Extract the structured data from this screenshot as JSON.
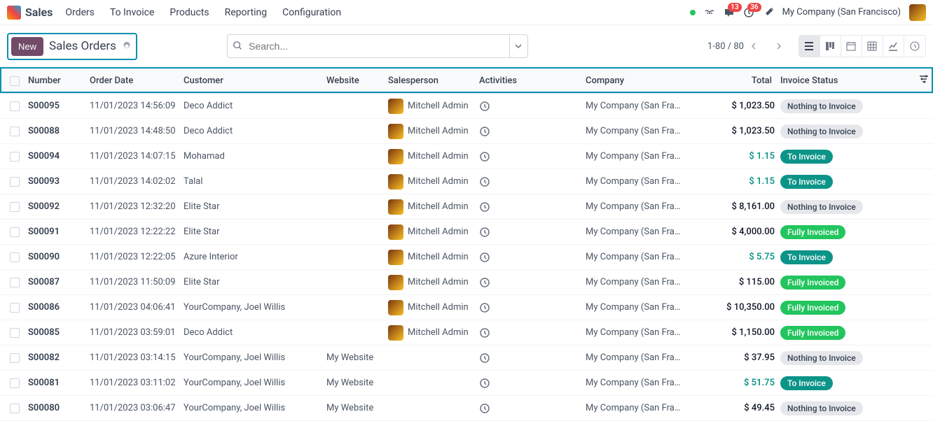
{
  "app": {
    "name": "Sales"
  },
  "nav": {
    "links": [
      "Orders",
      "To Invoice",
      "Products",
      "Reporting",
      "Configuration"
    ]
  },
  "top_right": {
    "msg_count": "13",
    "activity_count": "36",
    "company": "My Company (San Francisco)"
  },
  "breadcrumb": {
    "new_label": "New",
    "title": "Sales Orders"
  },
  "search": {
    "placeholder": "Search..."
  },
  "pager": {
    "text": "1-80 / 80"
  },
  "headers": {
    "number": "Number",
    "order_date": "Order Date",
    "customer": "Customer",
    "website": "Website",
    "salesperson": "Salesperson",
    "activities": "Activities",
    "company": "Company",
    "total": "Total",
    "invoice_status": "Invoice Status"
  },
  "statuses": {
    "nothing": "Nothing to Invoice",
    "to_invoice": "To Invoice",
    "fully": "Fully Invoiced"
  },
  "rows": [
    {
      "number": "S00095",
      "date": "11/01/2023 14:56:09",
      "customer": "Deco Addict",
      "website": "",
      "salesperson": "Mitchell Admin",
      "company": "My Company (San Francisco)",
      "total": "$ 1,023.50",
      "total_style": "dark",
      "status": "nothing",
      "status_style": "gray"
    },
    {
      "number": "S00088",
      "date": "11/01/2023 14:48:50",
      "customer": "Deco Addict",
      "website": "",
      "salesperson": "Mitchell Admin",
      "company": "My Company (San Francisco)",
      "total": "$ 1,023.50",
      "total_style": "dark",
      "status": "nothing",
      "status_style": "gray"
    },
    {
      "number": "S00094",
      "date": "11/01/2023 14:07:15",
      "customer": "Mohamad",
      "website": "",
      "salesperson": "Mitchell Admin",
      "company": "My Company (San Francisco)",
      "total": "$ 1.15",
      "total_style": "teal",
      "status": "to_invoice",
      "status_style": "teal"
    },
    {
      "number": "S00093",
      "date": "11/01/2023 14:02:02",
      "customer": "Talal",
      "website": "",
      "salesperson": "Mitchell Admin",
      "company": "My Company (San Francisco)",
      "total": "$ 1.15",
      "total_style": "teal",
      "status": "to_invoice",
      "status_style": "teal"
    },
    {
      "number": "S00092",
      "date": "11/01/2023 12:32:20",
      "customer": "Elite Star",
      "website": "",
      "salesperson": "Mitchell Admin",
      "company": "My Company (San Francisco)",
      "total": "$ 8,161.00",
      "total_style": "dark",
      "status": "nothing",
      "status_style": "gray"
    },
    {
      "number": "S00091",
      "date": "11/01/2023 12:22:22",
      "customer": "Elite Star",
      "website": "",
      "salesperson": "Mitchell Admin",
      "company": "My Company (San Francisco)",
      "total": "$ 4,000.00",
      "total_style": "dark",
      "status": "fully",
      "status_style": "green"
    },
    {
      "number": "S00090",
      "date": "11/01/2023 12:22:05",
      "customer": "Azure Interior",
      "website": "",
      "salesperson": "Mitchell Admin",
      "company": "My Company (San Francisco)",
      "total": "$ 5.75",
      "total_style": "teal",
      "status": "to_invoice",
      "status_style": "teal"
    },
    {
      "number": "S00087",
      "date": "11/01/2023 11:50:09",
      "customer": "Elite Star",
      "website": "",
      "salesperson": "Mitchell Admin",
      "company": "My Company (San Francisco)",
      "total": "$ 115.00",
      "total_style": "dark",
      "status": "fully",
      "status_style": "green"
    },
    {
      "number": "S00086",
      "date": "11/01/2023 04:06:41",
      "customer": "YourCompany, Joel Willis",
      "website": "",
      "salesperson": "Mitchell Admin",
      "company": "My Company (San Francisco)",
      "total": "$ 10,350.00",
      "total_style": "dark",
      "status": "fully",
      "status_style": "green"
    },
    {
      "number": "S00085",
      "date": "11/01/2023 03:59:01",
      "customer": "Deco Addict",
      "website": "",
      "salesperson": "Mitchell Admin",
      "company": "My Company (San Francisco)",
      "total": "$ 1,150.00",
      "total_style": "dark",
      "status": "fully",
      "status_style": "green"
    },
    {
      "number": "S00082",
      "date": "11/01/2023 03:14:15",
      "customer": "YourCompany, Joel Willis",
      "website": "My Website",
      "salesperson": "",
      "company": "My Company (San Francisco)",
      "total": "$ 37.95",
      "total_style": "dark",
      "status": "nothing",
      "status_style": "gray"
    },
    {
      "number": "S00081",
      "date": "11/01/2023 03:11:02",
      "customer": "YourCompany, Joel Willis",
      "website": "My Website",
      "salesperson": "",
      "company": "My Company (San Francisco)",
      "total": "$ 51.75",
      "total_style": "teal",
      "status": "to_invoice",
      "status_style": "teal"
    },
    {
      "number": "S00080",
      "date": "11/01/2023 03:06:47",
      "customer": "YourCompany, Joel Willis",
      "website": "My Website",
      "salesperson": "",
      "company": "My Company (San Francisco)",
      "total": "$ 49.45",
      "total_style": "dark",
      "status": "nothing",
      "status_style": "gray"
    }
  ]
}
